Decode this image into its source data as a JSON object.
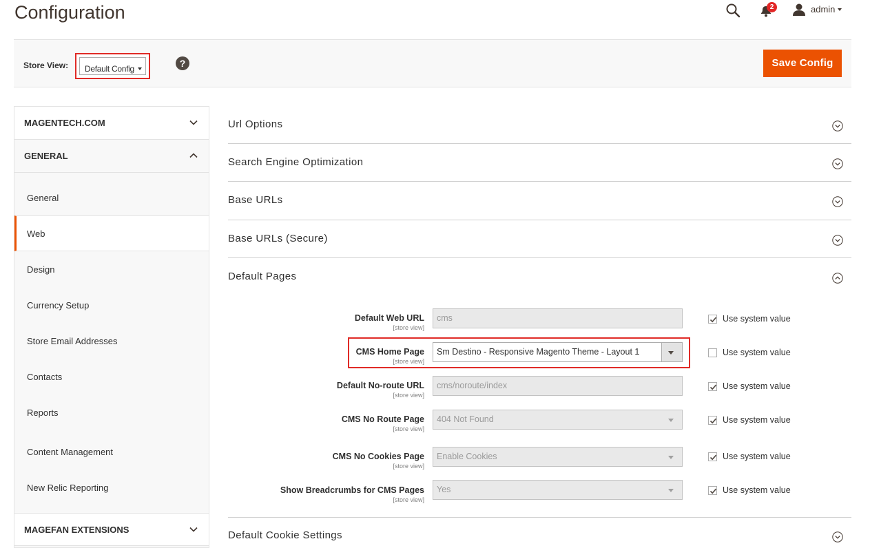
{
  "header": {
    "title": "Configuration",
    "notification_count": "2",
    "user_name": "admin"
  },
  "store_bar": {
    "label": "Store View:",
    "selected_scope": "Default Config",
    "help_glyph": "?",
    "save_label": "Save Config"
  },
  "sidebar": {
    "sections": [
      {
        "label": "MAGENTECH.COM",
        "expanded": false
      },
      {
        "label": "GENERAL",
        "expanded": true
      },
      {
        "label": "MAGEFAN EXTENSIONS",
        "expanded": false
      }
    ],
    "items": [
      {
        "label": "General"
      },
      {
        "label": "Web",
        "active": true
      },
      {
        "label": "Design"
      },
      {
        "label": "Currency Setup"
      },
      {
        "label": "Store Email Addresses"
      },
      {
        "label": "Contacts"
      },
      {
        "label": "Reports"
      },
      {
        "label": "Content Management"
      },
      {
        "label": "New Relic Reporting"
      }
    ]
  },
  "main": {
    "sections": [
      {
        "title": "Url Options",
        "expanded": false
      },
      {
        "title": "Search Engine Optimization",
        "expanded": false
      },
      {
        "title": "Base URLs",
        "expanded": false
      },
      {
        "title": "Base URLs (Secure)",
        "expanded": false
      },
      {
        "title": "Default Pages",
        "expanded": true
      },
      {
        "title": "Default Cookie Settings",
        "expanded": false
      }
    ],
    "default_pages": {
      "scope_text": "[store view]",
      "system_value_label": "Use system value",
      "fields": [
        {
          "label": "Default Web URL",
          "value": "cms",
          "type": "text",
          "use_system": true
        },
        {
          "label": "CMS Home Page",
          "value": "Sm Destino - Responsive Magento Theme - Layout 1",
          "type": "select",
          "use_system": false
        },
        {
          "label": "Default No-route URL",
          "value": "cms/noroute/index",
          "type": "text",
          "use_system": true
        },
        {
          "label": "CMS No Route Page",
          "value": "404 Not Found",
          "type": "select",
          "use_system": true
        },
        {
          "label": "CMS No Cookies Page",
          "value": "Enable Cookies",
          "type": "select",
          "use_system": true
        },
        {
          "label": "Show Breadcrumbs for CMS Pages",
          "value": "Yes",
          "type": "select",
          "use_system": true
        }
      ]
    }
  },
  "colors": {
    "accent": "#eb5202",
    "highlight_border": "#e02b27",
    "badge": "#e22626"
  }
}
